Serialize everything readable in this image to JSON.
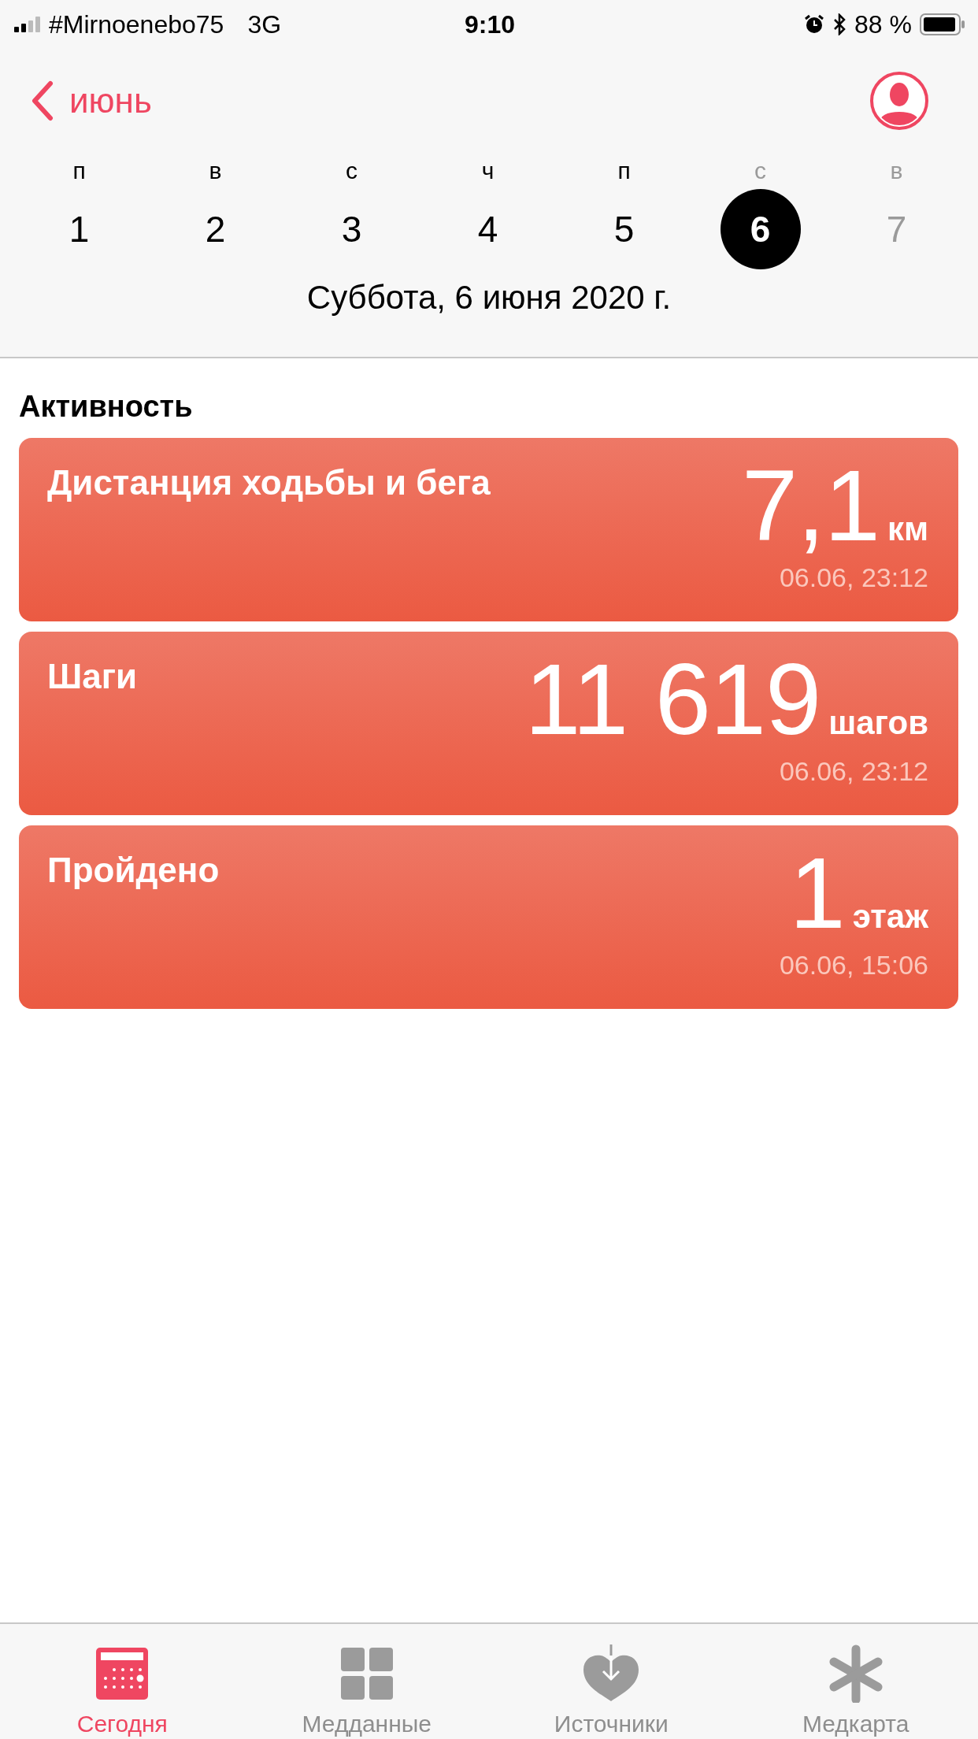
{
  "status_bar": {
    "carrier": "#Mirnoenebo75",
    "network": "3G",
    "time": "9:10",
    "battery": "88 %"
  },
  "nav": {
    "back_label": "июнь"
  },
  "week": [
    {
      "letter": "п",
      "number": "1",
      "weekend": false,
      "future": false,
      "selected": false
    },
    {
      "letter": "в",
      "number": "2",
      "weekend": false,
      "future": false,
      "selected": false
    },
    {
      "letter": "с",
      "number": "3",
      "weekend": false,
      "future": false,
      "selected": false
    },
    {
      "letter": "ч",
      "number": "4",
      "weekend": false,
      "future": false,
      "selected": false
    },
    {
      "letter": "п",
      "number": "5",
      "weekend": false,
      "future": false,
      "selected": false
    },
    {
      "letter": "с",
      "number": "6",
      "weekend": true,
      "future": false,
      "selected": true
    },
    {
      "letter": "в",
      "number": "7",
      "weekend": true,
      "future": true,
      "selected": false
    }
  ],
  "date_label": "Суббота, 6 июня 2020 г.",
  "section_title": "Активность",
  "cards": [
    {
      "title": "Дистанция ходьбы и бега",
      "value": "7,1",
      "unit": "км",
      "time": "06.06, 23:12"
    },
    {
      "title": "Шаги",
      "value": "11 619",
      "unit": "шагов",
      "time": "06.06, 23:12"
    },
    {
      "title": "Пройдено",
      "value": "1",
      "unit": "этаж",
      "time": "06.06, 15:06"
    }
  ],
  "tabs": [
    {
      "label": "Сегодня",
      "selected": true
    },
    {
      "label": "Медданные",
      "selected": false
    },
    {
      "label": "Источники",
      "selected": false
    },
    {
      "label": "Медкарта",
      "selected": false
    }
  ]
}
